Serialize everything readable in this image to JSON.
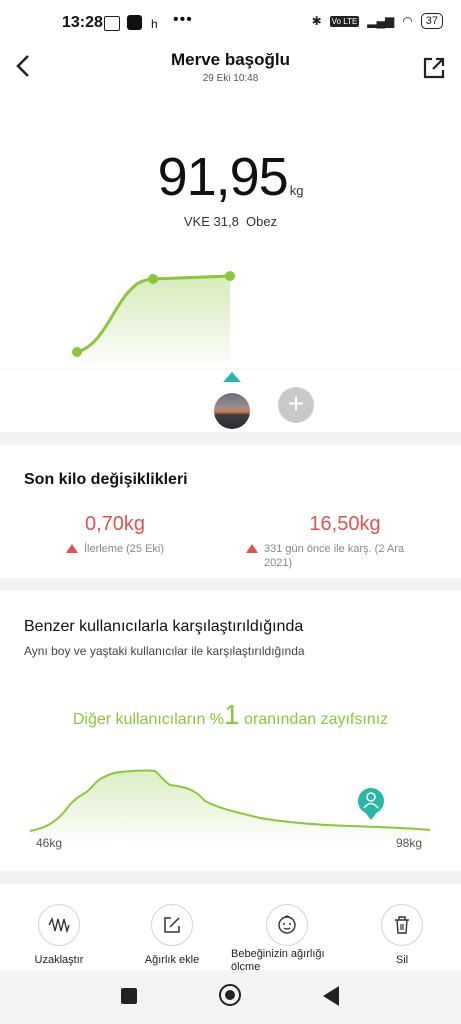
{
  "status_bar": {
    "time": "13:28",
    "app_letter": "h",
    "net_label": "Vo LTE",
    "battery": "37"
  },
  "header": {
    "title": "Merve başoğlu",
    "subtitle": "29 Eki 10:48"
  },
  "weight": {
    "value": "91,95",
    "unit": "kg",
    "bmi_text": "VKE 31,8",
    "category": "Obez"
  },
  "changes": {
    "title": "Son kilo değişiklikleri",
    "left": {
      "value": "0,70kg",
      "desc": "İlerleme (25 Eki)"
    },
    "right": {
      "value": "16,50kg",
      "desc_line1": "331 gün önce ile karş. (2 Ara",
      "desc_line2": "2021)"
    }
  },
  "comparison": {
    "title": "Benzer kullanıcılarla karşılaştırıldığında",
    "subtitle": "Aynı boy ve yaştaki kullanıcılar ile karşılaştırıldığında",
    "result_prefix": "Diğer kullanıcıların %",
    "result_value": "1",
    "result_suffix": " oranından zayıfsınız",
    "min_label": "46kg",
    "max_label": "98kg"
  },
  "toolbar": {
    "zoom_out": "Uzaklaştır",
    "add_weight": "Ağırlık ekle",
    "baby_weight": "Bebeğinizin ağırlığı ölçme",
    "delete": "Sil"
  },
  "colors": {
    "accent_green": "#8cc63f",
    "teal": "#2bb7a8",
    "red": "#e05252"
  }
}
